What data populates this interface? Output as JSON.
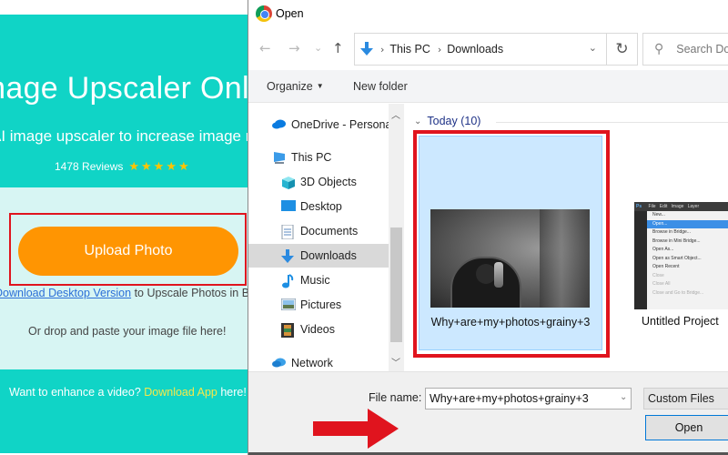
{
  "website": {
    "hero_title": "Image Upscaler Online",
    "hero_subtitle": "AI image upscaler to increase image resolution",
    "reviews_count": "1478 Reviews",
    "rating_stars": 5,
    "stars": "★★★★★",
    "upload_button": "Upload Photo",
    "desktop_link": "Download Desktop Version",
    "desktop_suffix": " to Upscale Photos in Batch",
    "drop_text": "Or drop and paste your image file here!",
    "video_prefix": "Want to enhance a video? ",
    "video_link": "Download App",
    "video_suffix": " here!",
    "colors": {
      "hero": "#10d4c6",
      "upload_area": "#d7f5f3",
      "button": "#ff9502",
      "highlight": "#e0141e",
      "link": "#2c6fd8",
      "video_link": "#f6e84a"
    }
  },
  "dialog": {
    "title": "Open",
    "title_icon": "chrome-icon",
    "nav": {
      "back": "←",
      "forward": "→",
      "recent": "⌄",
      "up": "↑"
    },
    "address": {
      "crumbs": [
        "This PC",
        "Downloads"
      ],
      "separator": "›",
      "dropdown": "⌄"
    },
    "refresh": "↻",
    "search_placeholder": "Search Downloads",
    "toolbar": {
      "organize": "Organize",
      "organize_caret": "▼",
      "new_folder": "New folder"
    },
    "tree": [
      {
        "label": "OneDrive - Personal",
        "icon": "onedrive-icon"
      },
      {
        "label": "This PC",
        "icon": "computer-icon"
      },
      {
        "label": "3D Objects",
        "icon": "3d-objects-icon"
      },
      {
        "label": "Desktop",
        "icon": "desktop-icon"
      },
      {
        "label": "Documents",
        "icon": "documents-icon"
      },
      {
        "label": "Downloads",
        "icon": "downloads-icon",
        "selected": true
      },
      {
        "label": "Music",
        "icon": "music-icon"
      },
      {
        "label": "Pictures",
        "icon": "pictures-icon"
      },
      {
        "label": "Videos",
        "icon": "videos-icon"
      },
      {
        "label": "Network",
        "icon": "network-icon"
      }
    ],
    "group": {
      "label": "Today (10)",
      "chevron": "⌄"
    },
    "files": [
      {
        "name": "Why+are+my+photos+grainy+3",
        "selected": true
      },
      {
        "name": "Untitled Project"
      }
    ],
    "ps_thumb": {
      "logo": "Ps",
      "menubar": [
        "File",
        "Edit",
        "Image",
        "Layer"
      ],
      "menu_items": [
        "New...",
        "Open...",
        "Browse in Bridge...",
        "Browse in Mini Bridge...",
        "Open As...",
        "Open as Smart Object...",
        "Open Recent",
        "Close",
        "Close All",
        "Close and Go to Bridge..."
      ]
    },
    "file_name_label": "File name:",
    "file_name_value": "Why+are+my+photos+grainy+3",
    "file_type": "Custom Files",
    "open_button": "Open",
    "colors": {
      "selection_fill": "#cce8ff",
      "selection_border": "#99d1ff",
      "annotation": "#e0141e",
      "open_border": "#0078d7"
    }
  }
}
